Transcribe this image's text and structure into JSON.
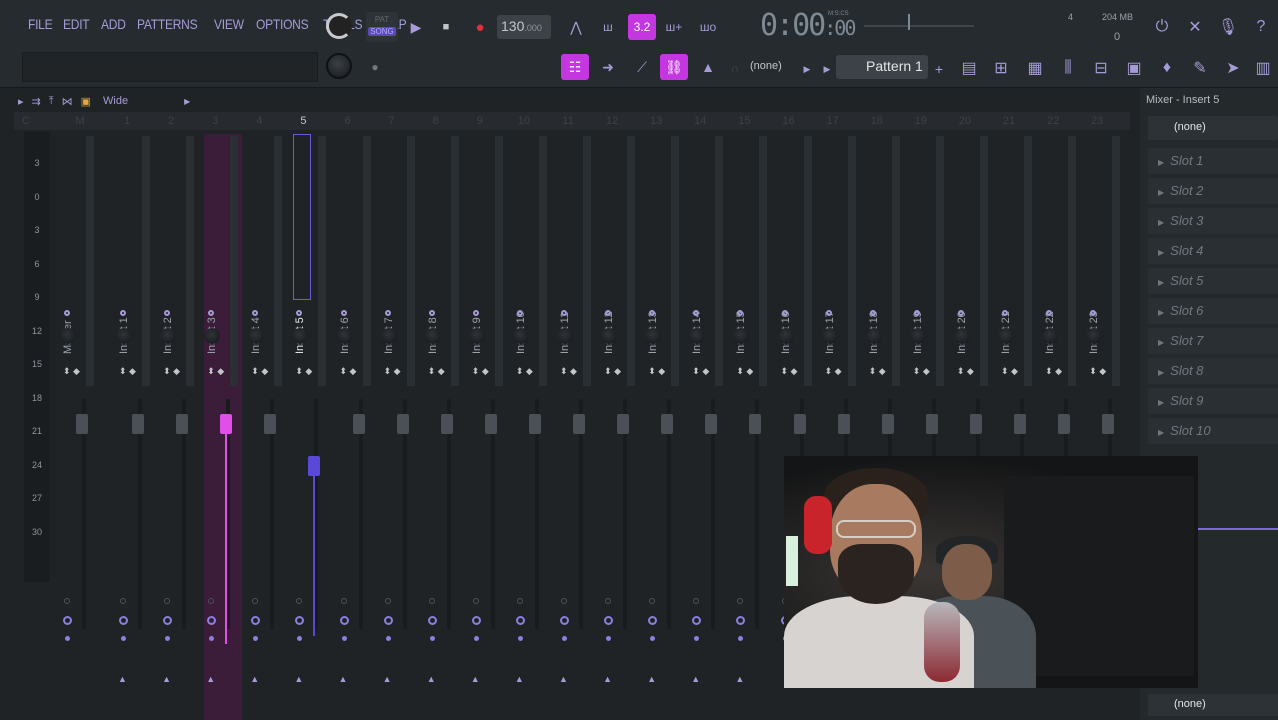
{
  "menu": [
    "FILE",
    "EDIT",
    "ADD",
    "PATTERNS",
    "VIEW",
    "OPTIONS",
    "TOOLS",
    "HELP"
  ],
  "transport": {
    "pat_label": "PAT",
    "song_label": "SONG",
    "tempo": "130",
    "tempo_decimals": ".000"
  },
  "timer": {
    "main": "0:00",
    "sub": ":00",
    "caption": "M:S:CS"
  },
  "cpu": {
    "voices": "4",
    "ram": "204 MB",
    "poly": "0"
  },
  "toolbar2": {
    "channel_selector": "(none)",
    "pattern": "Pattern 1"
  },
  "mixer": {
    "view_mode": "Wide",
    "ruler": [
      "C",
      "M",
      "1",
      "2",
      "3",
      "4",
      "5",
      "6",
      "7",
      "8",
      "9",
      "10",
      "11",
      "12",
      "13",
      "14",
      "15",
      "16",
      "17",
      "18",
      "19",
      "20",
      "21",
      "22",
      "23"
    ],
    "selected_ruler": "5",
    "db_scale": [
      "3",
      "0",
      "3",
      "6",
      "9",
      "12",
      "15",
      "18",
      "21",
      "24",
      "27",
      "30"
    ],
    "tracks": [
      "Master",
      "Insert 1",
      "Insert 2",
      "Insert 3",
      "Insert 4",
      "Insert 5",
      "Insert 6",
      "Insert 7",
      "Insert 8",
      "Insert 9",
      "Insert 10",
      "Insert 11",
      "Insert 12",
      "Insert 13",
      "Insert 14",
      "Insert 15",
      "Insert 16",
      "Insert 17",
      "Insert 18",
      "Insert 19",
      "Insert 20",
      "Insert 21",
      "Insert 22",
      "Insert 23"
    ],
    "highlighted_track": "Insert 3",
    "selected_track": "Insert 5"
  },
  "right_panel": {
    "title": "Mixer - Insert 5",
    "input": "(none)",
    "slots": [
      "Slot 1",
      "Slot 2",
      "Slot 3",
      "Slot 4",
      "Slot 5",
      "Slot 6",
      "Slot 7",
      "Slot 8",
      "Slot 9",
      "Slot 10"
    ],
    "output": "(none)"
  },
  "colors": {
    "accent": "#c437e0",
    "menu": "#a69bd6",
    "selected_fader": "#5a49d8",
    "highlight_strip": "#3b1d3a"
  }
}
